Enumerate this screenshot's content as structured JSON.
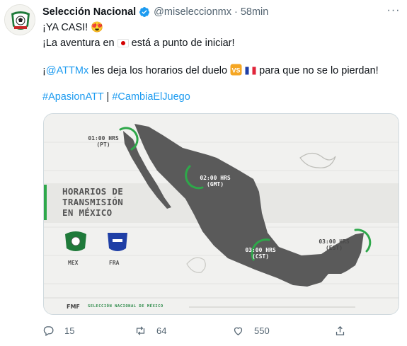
{
  "tweet": {
    "author_name": "Selección Nacional",
    "handle": "@miseleccionmx",
    "separator": "·",
    "time": "58min",
    "more_label": "···",
    "line1": "¡YA CASI! 😍",
    "line2_a": "¡La aventura en",
    "line2_b": "está a punto de iniciar!",
    "line3_a": "¡",
    "line3_mention": "@ATTMx",
    "line3_b": "les deja los horarios del duelo",
    "line3_c": "para que no se lo pierdan!",
    "hashtag1": "#ApasionATT",
    "hashtag_sep": "|",
    "hashtag2": "#CambiaElJuego"
  },
  "media": {
    "title_line1": "HORARIOS DE",
    "title_line2": "TRANSMISIÓN",
    "title_line3": "EN MÉXICO",
    "team_home": "MEX",
    "team_away": "FRA",
    "vs_label": "V\nS",
    "times": [
      {
        "time": "01:00 HRS",
        "zone": "(PT)"
      },
      {
        "time": "02:00 HRS",
        "zone": "(GMT)"
      },
      {
        "time": "03:00 HRS",
        "zone": "(CST)"
      },
      {
        "time": "03:00 HRS",
        "zone": "(EST)"
      }
    ],
    "footer_logo": "FMF",
    "footer_text": "SELECCIÓN NACIONAL DE MÉXICO",
    "map_color": "#5a5a5a",
    "accent_green": "#2ea84a"
  },
  "actions": {
    "replies": "15",
    "retweets": "64",
    "likes": "550"
  },
  "icons": {
    "verified": "verified-badge-icon",
    "reply": "reply-icon",
    "retweet": "retweet-icon",
    "like": "heart-icon",
    "share": "share-icon"
  }
}
